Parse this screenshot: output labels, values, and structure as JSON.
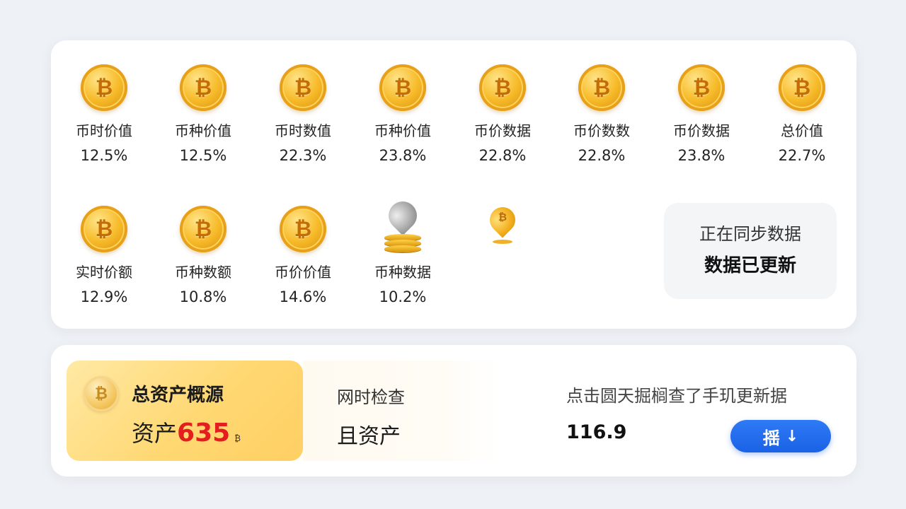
{
  "coins_row1": [
    {
      "label": "币时价值",
      "value": "12.5%"
    },
    {
      "label": "币种价值",
      "value": "12.5%"
    },
    {
      "label": "币时数值",
      "value": "22.3%"
    },
    {
      "label": "币种价值",
      "value": "23.8%"
    },
    {
      "label": "币价数据",
      "value": "22.8%"
    },
    {
      "label": "币价数数",
      "value": "22.8%"
    },
    {
      "label": "币价数据",
      "value": "23.8%"
    },
    {
      "label": "总价值",
      "value": "22.7%"
    }
  ],
  "coins_row2": [
    {
      "label": "实时价额",
      "value": "12.9%"
    },
    {
      "label": "币种数额",
      "value": "10.8%"
    },
    {
      "label": "币价价值",
      "value": "14.6%"
    },
    {
      "label": "币种数据",
      "value": "10.2%"
    }
  ],
  "coin_glyph": "₿",
  "icons": {
    "coin": "bitcoin-coin-icon",
    "pin_stack": "location-pin-coin-stack-icon",
    "small_pin": "bitcoin-pin-icon"
  },
  "status": {
    "line1": "正在同步数据",
    "line2": "数据已更新"
  },
  "summary": {
    "title": "总资产概源",
    "asset_prefix": "资产",
    "asset_number": "635",
    "asset_unit": "₿"
  },
  "check": {
    "label": "网时检查",
    "value": "且资产"
  },
  "update": {
    "hint": "点击圆天掘榈查了手玑更新据",
    "value": "116.9",
    "button_label": "揺",
    "button_arrow": "↓"
  },
  "colors": {
    "accent_blue": "#1a62e6",
    "highlight_red": "#e41e1e",
    "gold": "#f7bb2a"
  }
}
